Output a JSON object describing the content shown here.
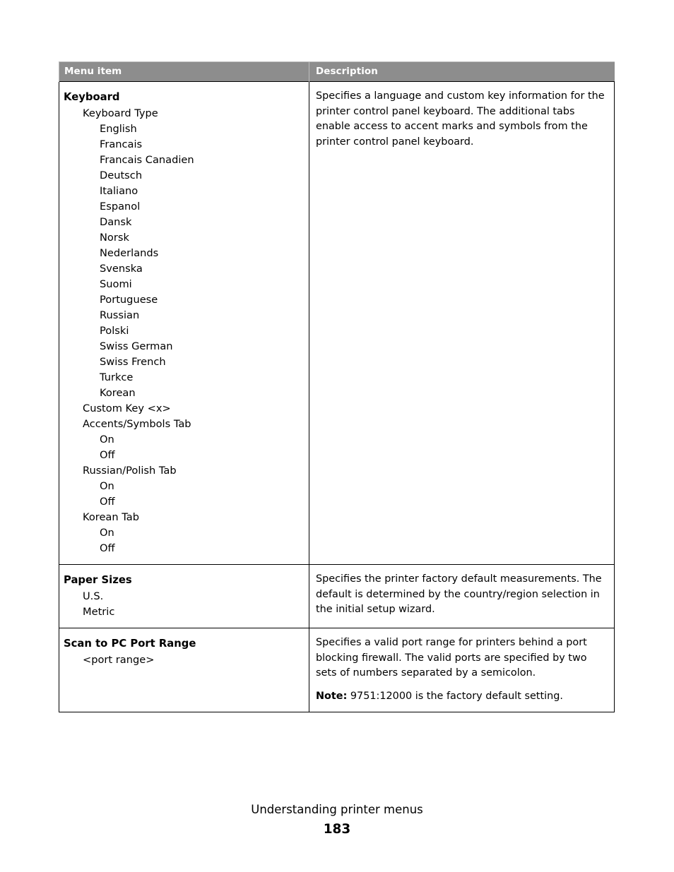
{
  "document": {
    "footer_title": "Understanding printer menus",
    "page_number": "183"
  },
  "table": {
    "columns": {
      "menu_item": "Menu item",
      "description": "Description"
    },
    "header_bg": "#8d8d8d",
    "header_text_color": "#ffffff",
    "border_color": "#000000",
    "rows": [
      {
        "title": "Keyboard",
        "items": [
          {
            "level": 1,
            "label": "Keyboard Type"
          },
          {
            "level": 2,
            "label": "English"
          },
          {
            "level": 2,
            "label": "Francais"
          },
          {
            "level": 2,
            "label": "Francais Canadien"
          },
          {
            "level": 2,
            "label": "Deutsch"
          },
          {
            "level": 2,
            "label": "Italiano"
          },
          {
            "level": 2,
            "label": "Espanol"
          },
          {
            "level": 2,
            "label": "Dansk"
          },
          {
            "level": 2,
            "label": "Norsk"
          },
          {
            "level": 2,
            "label": "Nederlands"
          },
          {
            "level": 2,
            "label": "Svenska"
          },
          {
            "level": 2,
            "label": "Suomi"
          },
          {
            "level": 2,
            "label": "Portuguese"
          },
          {
            "level": 2,
            "label": "Russian"
          },
          {
            "level": 2,
            "label": "Polski"
          },
          {
            "level": 2,
            "label": "Swiss German"
          },
          {
            "level": 2,
            "label": "Swiss French"
          },
          {
            "level": 2,
            "label": "Turkce"
          },
          {
            "level": 2,
            "label": "Korean"
          },
          {
            "level": 1,
            "label": "Custom Key <x>"
          },
          {
            "level": 1,
            "label": "Accents/Symbols Tab"
          },
          {
            "level": 2,
            "label": "On"
          },
          {
            "level": 2,
            "label": "Off"
          },
          {
            "level": 1,
            "label": "Russian/Polish Tab"
          },
          {
            "level": 2,
            "label": "On"
          },
          {
            "level": 2,
            "label": "Off"
          },
          {
            "level": 1,
            "label": "Korean Tab"
          },
          {
            "level": 2,
            "label": "On"
          },
          {
            "level": 2,
            "label": "Off"
          }
        ],
        "description": [
          {
            "text": "Specifies a language and custom key information for the printer control panel keyboard. The additional tabs enable access to accent marks and symbols from the printer control panel keyboard."
          }
        ]
      },
      {
        "title": "Paper Sizes",
        "items": [
          {
            "level": 1,
            "label": "U.S."
          },
          {
            "level": 1,
            "label": "Metric"
          }
        ],
        "description": [
          {
            "text": "Specifies the printer factory default measurements. The default is determined by the country/region selection in the initial setup wizard."
          }
        ]
      },
      {
        "title": "Scan to PC Port Range",
        "items": [
          {
            "level": 1,
            "label": "<port range>"
          }
        ],
        "description": [
          {
            "text": "Specifies a valid port range for printers behind a port blocking firewall. The valid ports are specified by two sets of numbers separated by a semicolon."
          },
          {
            "bold_prefix": "Note:",
            "text": " 9751:12000 is the factory default setting."
          }
        ]
      }
    ]
  }
}
